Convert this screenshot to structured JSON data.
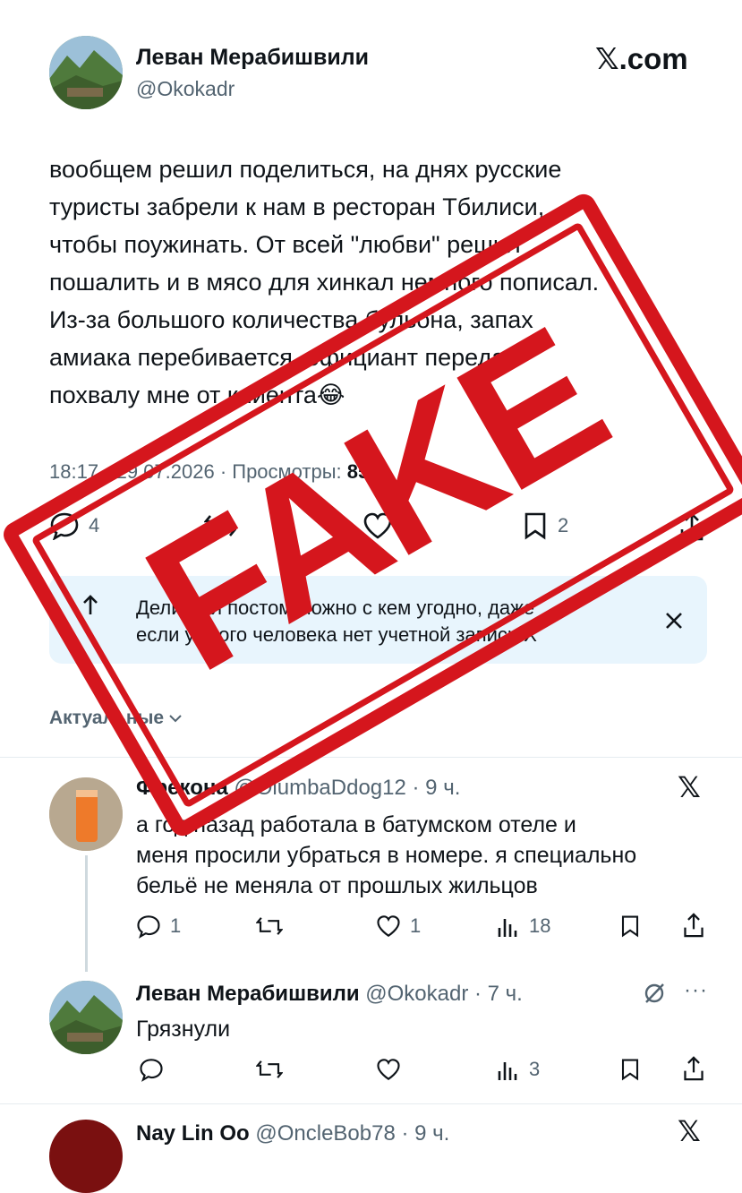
{
  "post": {
    "author_name": "Леван Мерабишвили",
    "handle": "@Okokadr",
    "source": "𝕏.com",
    "lines": [
      "вообщем решил поделиться, на днях русские",
      "туристы забрели к нам в ресторан Тбилиси,",
      "чтобы поужинать. От всей \"любви\" решил",
      "пошалить и в мясо для хинкал немного пописал.",
      "Из-за большого количества бульона, запах",
      "амиака перебивается. официант передал",
      "похвалу мне от клиента😂"
    ],
    "meta_time": "18:17 · 29.07.2026 · Просмотры:",
    "meta_views": "85",
    "stats": {
      "replies": "4",
      "likes": "9",
      "bookmarks": "2"
    }
  },
  "share_banner": {
    "line1": "Делиться постом можно с кем угодно, даже",
    "line2": "если у этого человека нет учетной записи X"
  },
  "sort": {
    "label": "Актуальные"
  },
  "replies": [
    {
      "name": "Фрекона",
      "handle": "@OlumbaDdog12 · 9 ч.",
      "lines": [
        "а год назад работала в батумском отеле и",
        "меня просили убраться в номере. я специально",
        "бельё не меняла от прошлых жильцов"
      ],
      "stats": {
        "replies": "1",
        "likes": "1",
        "views": "18"
      }
    },
    {
      "name": "Леван Мерабишвили",
      "handle": "@Okokadr · 7 ч.",
      "text": "Грязнули",
      "stats": {
        "views": "3"
      }
    },
    {
      "name": "Nay Lin Oo",
      "handle": "@OncleBob78 · 9 ч."
    }
  ],
  "stamp": {
    "text": "FAKE",
    "color": "#d5161d"
  },
  "colors": {
    "text": "#0f1419",
    "muted": "#536471",
    "banner": "#e8f5fd",
    "accent": "#d5161d"
  }
}
